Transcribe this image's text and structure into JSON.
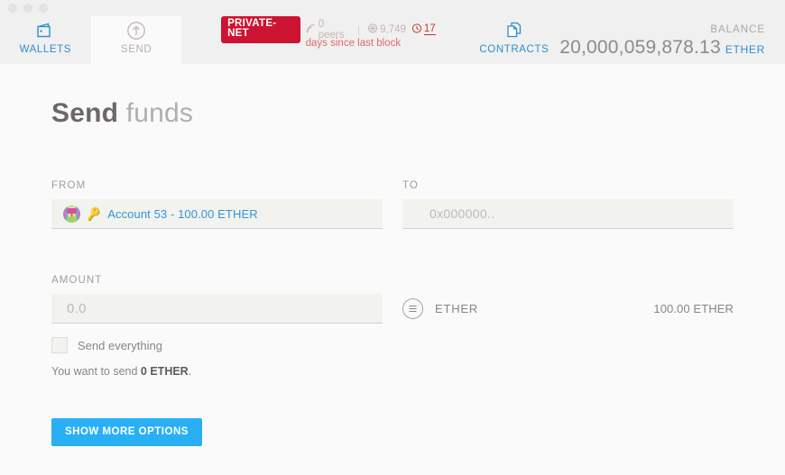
{
  "window": {
    "dots": [
      "close",
      "minimize",
      "maximize"
    ]
  },
  "nav": {
    "tabs": [
      {
        "label": "WALLETS",
        "icon": "wallet-icon",
        "state": "inactive",
        "color": "#2b8fd0"
      },
      {
        "label": "SEND",
        "icon": "send-arrow-icon",
        "state": "active",
        "color": "#b9aeae"
      },
      {
        "label": "CONTRACTS",
        "icon": "contracts-icon",
        "state": "inactive",
        "color": "#2b8fd0"
      }
    ]
  },
  "status": {
    "network_badge": "PRIVATE-NET",
    "network_badge_color": "#cc1432",
    "peers": {
      "icon": "signal-icon",
      "value": "0 peers"
    },
    "divider": "|",
    "blocks": {
      "icon": "block-icon",
      "value": "9,749"
    },
    "time": {
      "icon": "clock-icon",
      "value": "17"
    },
    "sub_label": "days since last block",
    "sub_label_color": "#e06a6a"
  },
  "balance": {
    "label": "BALANCE",
    "value": "20,000,059,878.13",
    "unit": "ETHER",
    "unit_color": "#2b8fd0"
  },
  "page": {
    "title_bold": "Send",
    "title_light": " funds"
  },
  "form": {
    "from": {
      "label": "FROM",
      "avatar": "identicon-avatar",
      "key_icon": "🔑",
      "account_text": "Account 53 - 100.00 ETHER",
      "account_color": "#2f97d8"
    },
    "to": {
      "label": "TO",
      "placeholder": "0x000000..",
      "value": ""
    },
    "amount": {
      "label": "AMOUNT",
      "placeholder": "0.0",
      "value": ""
    },
    "unit_selector": {
      "icon": "unit-list-icon",
      "name": "ETHER",
      "available": "100.00 ETHER"
    },
    "send_everything": {
      "label": "Send everything",
      "checked": false
    },
    "summary_prefix": "You want to send ",
    "summary_amount": "0 ETHER",
    "summary_suffix": ".",
    "show_more_options_button": "SHOW MORE OPTIONS",
    "button_color": "#29b0f4"
  }
}
